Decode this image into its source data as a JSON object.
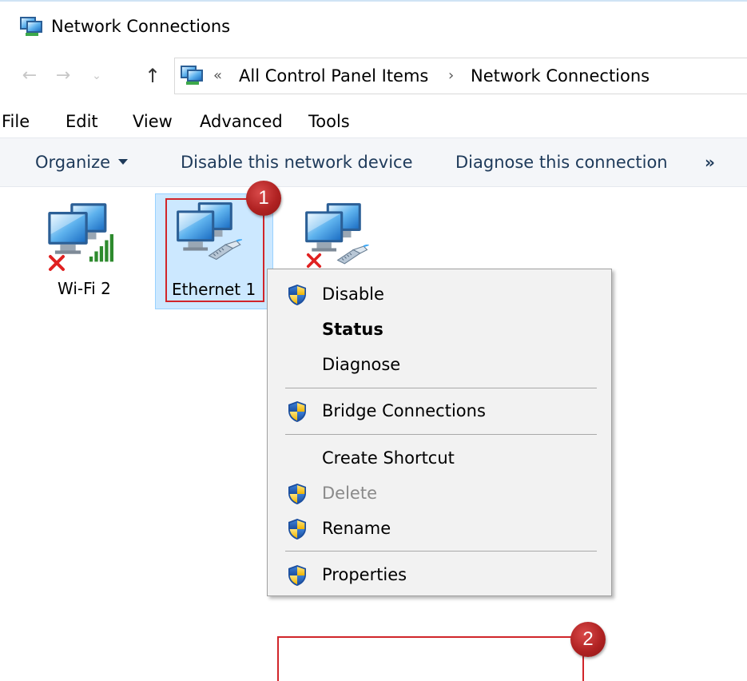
{
  "window": {
    "title": "Network Connections"
  },
  "address": {
    "overflow_chevron": "«",
    "crumbs": [
      "All Control Panel Items",
      "Network Connections"
    ],
    "separator": "›"
  },
  "nav": {
    "back": "←",
    "forward": "→",
    "recent": "⌄",
    "up": "↑"
  },
  "menu": [
    "File",
    "Edit",
    "View",
    "Advanced",
    "Tools"
  ],
  "commands": {
    "organize": "Organize",
    "disable_device": "Disable this network device",
    "diagnose": "Diagnose this connection",
    "more": "»"
  },
  "connections": [
    {
      "label": "Wi-Fi 2",
      "icon": "wifi-adapter-icon",
      "status": "disconnected"
    },
    {
      "label": "Ethernet 1",
      "icon": "ethernet-adapter-icon",
      "status": "selected"
    },
    {
      "label": "",
      "icon": "ethernet-adapter-icon",
      "status": "disconnected"
    }
  ],
  "context_menu": {
    "items": [
      {
        "label": "Disable",
        "shield": true,
        "style": "normal"
      },
      {
        "label": "Status",
        "shield": false,
        "style": "bold"
      },
      {
        "label": "Diagnose",
        "shield": false,
        "style": "normal"
      },
      {
        "label": "Bridge Connections",
        "shield": true,
        "style": "normal"
      },
      {
        "label": "Create Shortcut",
        "shield": false,
        "style": "normal"
      },
      {
        "label": "Delete",
        "shield": true,
        "style": "disabled"
      },
      {
        "label": "Rename",
        "shield": true,
        "style": "normal"
      },
      {
        "label": "Properties",
        "shield": true,
        "style": "normal"
      }
    ]
  },
  "annotations": {
    "badge_1": "1",
    "badge_2": "2",
    "highlight_color": "#d1252a"
  },
  "colors": {
    "selection_bg": "#cce8ff",
    "command_text": "#1e3a5a"
  }
}
